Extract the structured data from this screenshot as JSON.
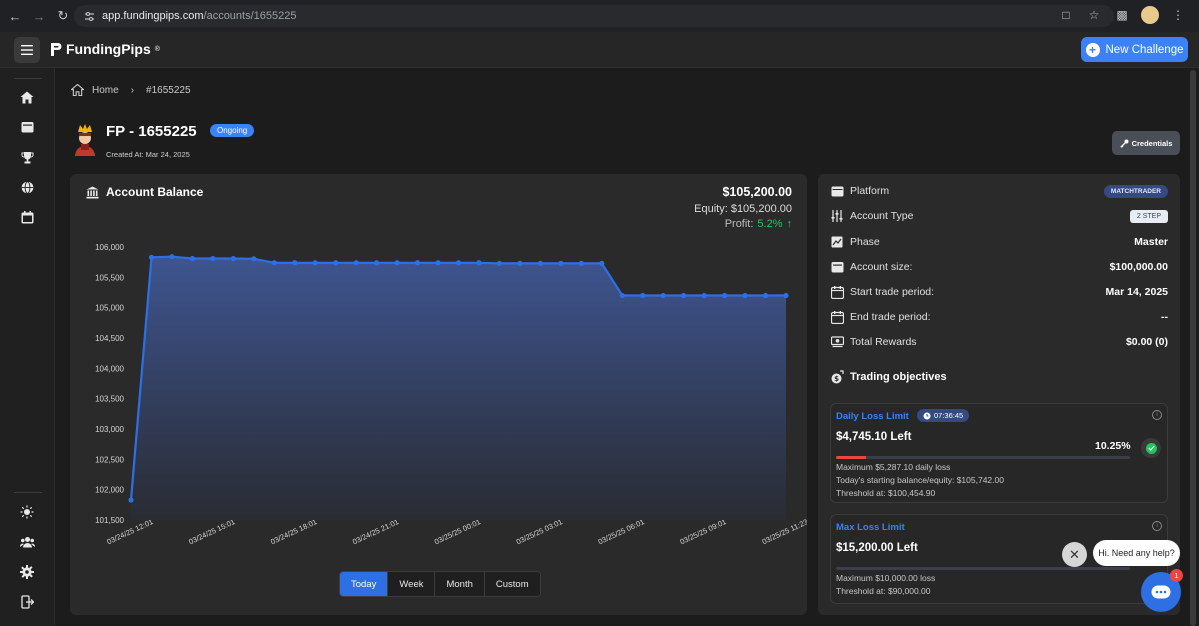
{
  "browser": {
    "url_host": "app.fundingpips.com",
    "url_path": "/accounts/1655225"
  },
  "header": {
    "brand": "FundingPips",
    "brand_mark": "®",
    "new_challenge_label": "New Challenge"
  },
  "breadcrumb": {
    "home": "Home",
    "current": "#1655225"
  },
  "account": {
    "title": "FP - 1655225",
    "status": "Ongoing",
    "created": "Created At: Mar 24, 2025",
    "credentials_label": "Credentials"
  },
  "balance": {
    "heading": "Account Balance",
    "amount": "$105,200.00",
    "equity": "Equity:  $105,200.00",
    "profit_label": "Profit:",
    "profit_value": "5.2%",
    "periods": [
      "Today",
      "Week",
      "Month",
      "Custom"
    ],
    "active_period": "Today"
  },
  "chart_data": {
    "type": "area",
    "title": "",
    "xlabel": "",
    "ylabel": "",
    "ylim": [
      101500,
      106000
    ],
    "y_ticks": [
      "106,000",
      "105,500",
      "105,000",
      "104,500",
      "104,000",
      "103,500",
      "103,000",
      "102,500",
      "102,000",
      "101,500"
    ],
    "x_ticks": [
      "03/24/25 12:01",
      "03/24/25 15:01",
      "03/24/25 18:01",
      "03/24/25 21:01",
      "03/25/25 00:01",
      "03/25/25 03:01",
      "03/25/25 06:01",
      "03/25/25 09:01",
      "03/25/25 11:23"
    ],
    "values": [
      101830,
      105830,
      105840,
      105810,
      105810,
      105810,
      105805,
      105740,
      105740,
      105740,
      105740,
      105740,
      105740,
      105740,
      105740,
      105740,
      105740,
      105740,
      105730,
      105730,
      105730,
      105730,
      105730,
      105730,
      105200,
      105200,
      105200,
      105200,
      105200,
      105200,
      105200,
      105200,
      105200
    ],
    "grid": false,
    "line_color": "#2f6fe4"
  },
  "info": {
    "rows": [
      {
        "label": "Platform",
        "value": "MATCHTRADER"
      },
      {
        "label": "Account Type",
        "value": "2 STEP"
      },
      {
        "label": "Phase",
        "value": "Master"
      },
      {
        "label": "Account size:",
        "value": "$100,000.00"
      },
      {
        "label": "Start trade period:",
        "value": "Mar 14, 2025"
      },
      {
        "label": "End trade period:",
        "value": "--"
      },
      {
        "label": "Total Rewards",
        "value": "$0.00 (0)"
      }
    ]
  },
  "objectives": {
    "title": "Trading objectives",
    "daily": {
      "name": "Daily Loss Limit",
      "timer": "07:36:45",
      "left": "$4,745.10 Left",
      "pct": "10.25%",
      "progress": 0.1025,
      "line1": "Maximum $5,287.10 daily loss",
      "line2": "Today's starting balance/equity: $105,742.00",
      "line3": "Threshold at: $100,454.90"
    },
    "max": {
      "name": "Max Loss Limit",
      "left": "$15,200.00 Left",
      "line1": "Maximum $10,000.00 loss",
      "line2": "Threshold at: $90,000.00"
    }
  },
  "chat": {
    "prompt": "Hi. Need any help?",
    "badge": "1"
  },
  "colors": {
    "accent": "#3b82f6",
    "profit": "#22c55e",
    "danger": "#ef4444"
  }
}
